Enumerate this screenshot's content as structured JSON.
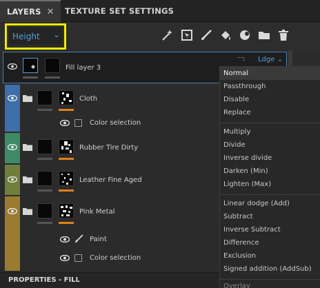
{
  "tabs": {
    "layers": "LAYERS",
    "layers_close": "✕",
    "texture_set_settings": "TEXTURE SET SETTINGS"
  },
  "channel_select": {
    "value": "Height",
    "chevron": "⌄"
  },
  "toolbar_icons": [
    "magic-wand-icon",
    "mask-icon",
    "paint-brush-icon",
    "fill-bucket-icon",
    "smart-material-icon",
    "folder-icon",
    "trash-icon"
  ],
  "layers": [
    {
      "name": "Fill layer 3",
      "blend": "Ldge",
      "selected": true
    },
    {
      "name": "Cloth",
      "color": "#3f6fa8",
      "sub": [
        {
          "name": "Color selection",
          "type": "checkbox"
        }
      ]
    },
    {
      "name": "Rubber Tire Dirty",
      "color": "#3e8a68"
    },
    {
      "name": "Leather Fine Aged",
      "color": "#6f7f3a"
    },
    {
      "name": "Pink Metal",
      "color": "#9a7b30",
      "sub": [
        {
          "name": "Paint",
          "type": "brush"
        },
        {
          "name": "Color selection",
          "type": "checkbox"
        }
      ]
    }
  ],
  "blend_modes": {
    "group1": [
      "Normal",
      "Passthrough",
      "Disable",
      "Replace"
    ],
    "group2": [
      "Multiply",
      "Divide",
      "Inverse divide",
      "Darken (Min)",
      "Lighten (Max)"
    ],
    "group3": [
      "Linear dodge (Add)",
      "Subtract",
      "Inverse Subtract",
      "Difference",
      "Exclusion",
      "Signed addition (AddSub)"
    ],
    "cut_off": "Overlay",
    "highlighted": "Normal"
  },
  "properties_title": "PROPERTIES - FILL",
  "colors": {
    "accent_blue": "#4f9fe2",
    "highlight_yellow": "#f2ea00",
    "orange_mask": "#e0801c"
  }
}
